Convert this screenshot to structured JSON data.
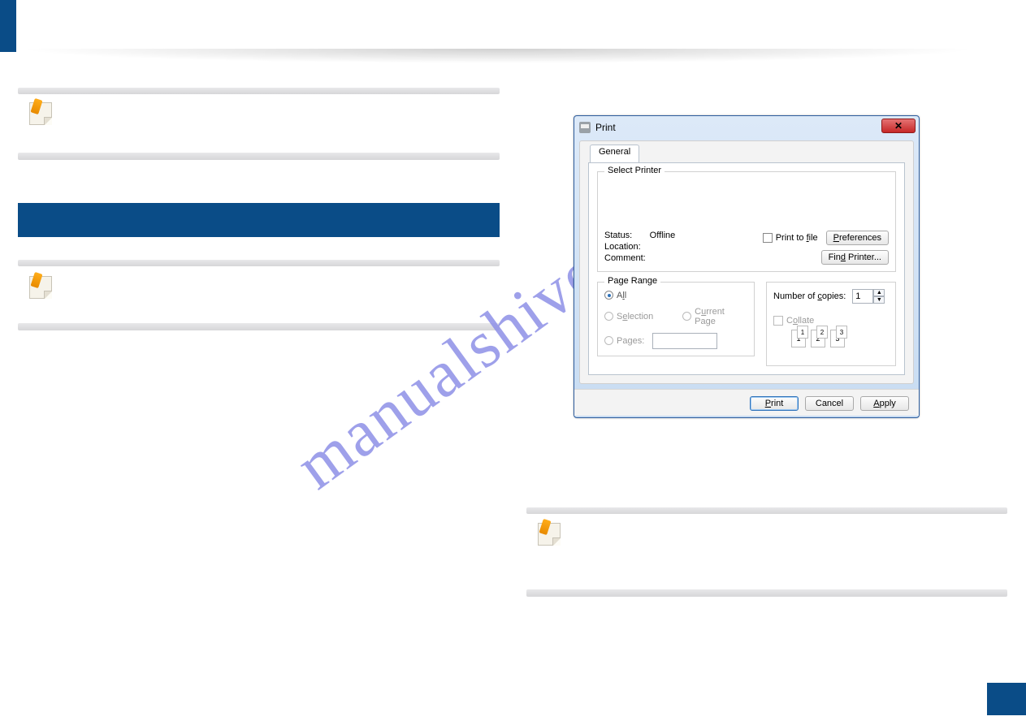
{
  "watermark": "manualshive.com",
  "dialog": {
    "title": "Print",
    "tab_general": "General",
    "select_printer": "Select Printer",
    "status_label": "Status:",
    "status_value": "Offline",
    "location_label": "Location:",
    "comment_label": "Comment:",
    "print_to_file": "Print to file",
    "preferences": "Preferences",
    "find_printer": "Find Printer...",
    "page_range": "Page Range",
    "opt_all": "All",
    "opt_selection": "Selection",
    "opt_current": "Current Page",
    "opt_pages": "Pages:",
    "num_copies": "Number of copies:",
    "copies_value": "1",
    "collate": "Collate",
    "collate_pages": [
      "1",
      "1",
      "2",
      "2",
      "3",
      "3"
    ],
    "btn_print": "Print",
    "btn_cancel": "Cancel",
    "btn_apply": "Apply"
  }
}
